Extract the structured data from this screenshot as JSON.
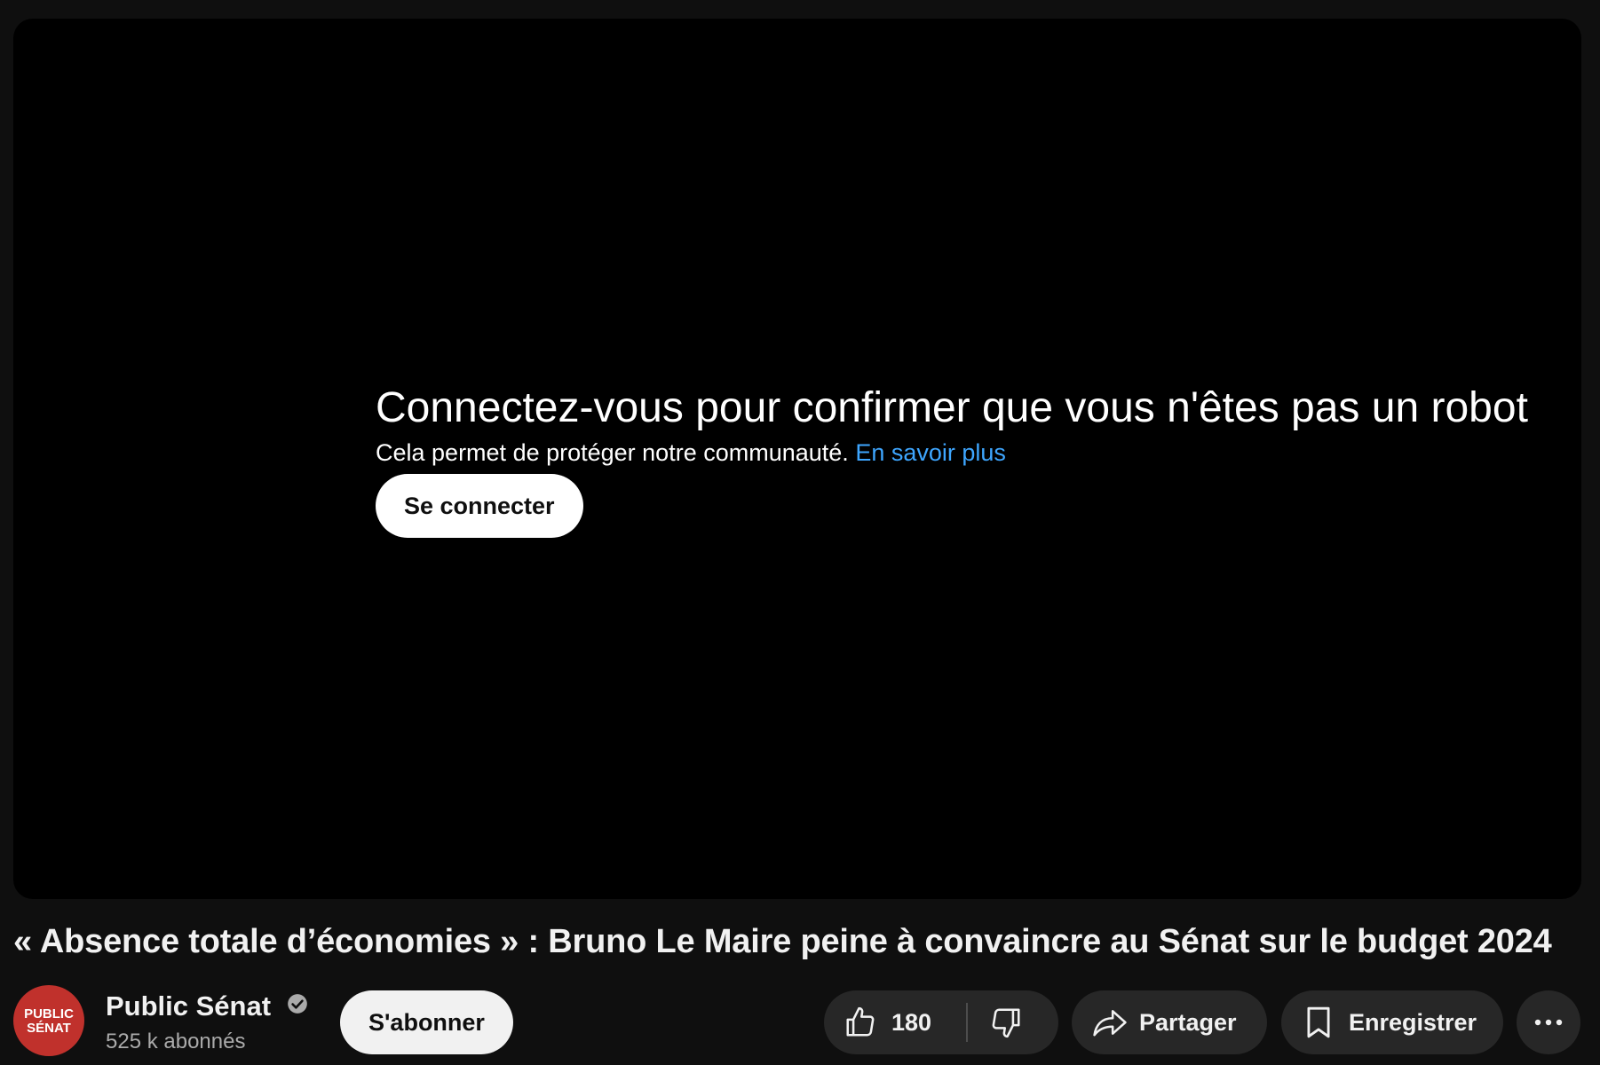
{
  "player": {
    "message_title": "Connectez-vous pour confirmer que vous n'êtes pas un robot",
    "message_subtitle": "Cela permet de protéger notre communauté.",
    "learn_more_link": "En savoir plus",
    "sign_in_button": "Se connecter"
  },
  "video": {
    "title": "« Absence totale d’économies » : Bruno Le Maire peine à convaincre au Sénat sur le budget 2024"
  },
  "channel": {
    "name": "Public Sénat",
    "subscribers": "525 k abonnés",
    "avatar_line1": "PUBLIC",
    "avatar_line2": "SÉNAT",
    "avatar_color": "#c0312c",
    "verified_icon": "verified-check-icon"
  },
  "actions": {
    "subscribe_label": "S'abonner",
    "like_count": "180",
    "share_label": "Partager",
    "save_label": "Enregistrer",
    "like_icon": "thumbs-up-icon",
    "dislike_icon": "thumbs-down-icon",
    "share_icon": "share-arrow-icon",
    "save_icon": "bookmark-icon",
    "more_icon": "more-horizontal-icon"
  },
  "colors": {
    "background": "#0f0f0f",
    "player_background": "#000000",
    "link": "#3ea6ff",
    "pill_background": "#272727"
  }
}
